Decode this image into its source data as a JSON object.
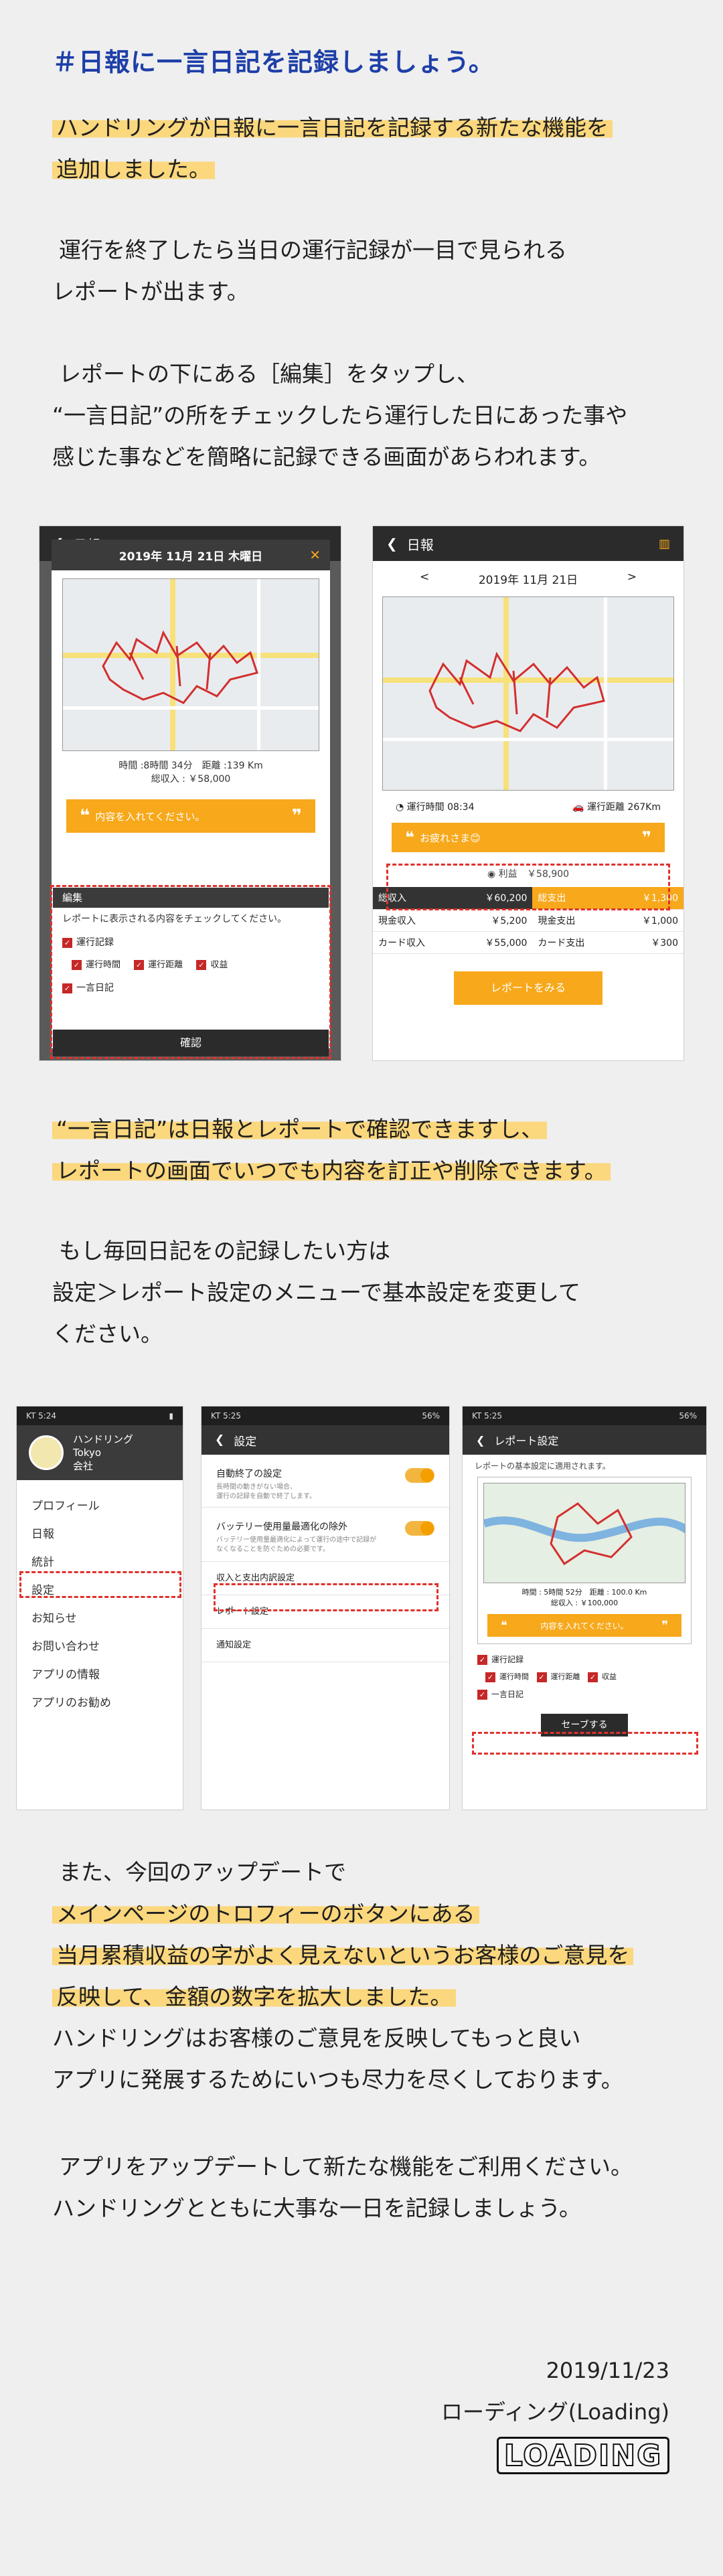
{
  "heading": "＃日報に一言日記を記録しましょう。",
  "intro_line1": "ハンドリングが日報に一言日記を記録する新たな機能を",
  "intro_line2": "追加しました。",
  "p2_line1": "運行を終了したら当日の運行記録が一目で見られる",
  "p2_line2": "レポートが出ます。",
  "p3_line1": "レポートの下にある［編集］をタップし、",
  "p3_line2": "“一言日記”の所をチェックしたら運行した日にあった事や",
  "p3_line3": "感じた事などを簡略に記録できる画面があらわれます。",
  "screen1": {
    "appbar_title": "日報",
    "date": "2019年 11月 21日 木曜日",
    "close": "✕",
    "stats_line1": "時間 :8時間 34分　距離 :139 Km",
    "stats_line2": "総収入 : ￥58,000",
    "memo_placeholder": "内容を入れてください。",
    "edit_label": "編集",
    "edit_desc": "レポートに表示される内容をチェックしてください。",
    "cb_run": "運行記録",
    "cb_time": "運行時間",
    "cb_distance": "運行距離",
    "cb_income": "収益",
    "cb_diary": "一言日記",
    "confirm": "確認"
  },
  "screen2": {
    "appbar_title": "日報",
    "prev": "<",
    "next": ">",
    "date": "2019年 11月 21日",
    "run_time_label": "運行時間",
    "run_time": "08:34",
    "run_dist_label": "運行距離",
    "run_dist": "267Km",
    "memo": "お疲れさま😊",
    "profit_label": "利益",
    "profit": "￥58,900",
    "table": [
      [
        "総収入",
        "￥60,200",
        "総支出",
        "￥1,300"
      ],
      [
        "現金収入",
        "￥5,200",
        "現金支出",
        "￥1,000"
      ],
      [
        "カード収入",
        "￥55,000",
        "カード支出",
        "￥300"
      ]
    ],
    "report_button": "レポートをみる"
  },
  "p4_line1": "“一言日記”は日報とレポートで確認できますし、",
  "p4_line2": "レポートの画面でいつでも内容を訂正や削除できます。",
  "p5_line1": "もし毎回日記をの記録したい方は",
  "p5_line2": "設定＞レポート設定のメニューで基本設定を変更して",
  "p5_line3": "ください。",
  "screen3": {
    "status_time": "KT 5:24",
    "user_name": "ハンドリング",
    "user_sub1": "Tokyo",
    "user_sub2": "会社",
    "menu": [
      "プロフィール",
      "日報",
      "統計",
      "設定",
      "お知らせ",
      "お問い合わせ",
      "アプリの情報",
      "アプリのお勧め"
    ]
  },
  "screen4": {
    "status_time": "KT 5:25",
    "status_right": "56%",
    "appbar_title": "設定",
    "auto_end": "自動終了の設定",
    "auto_end_desc1": "長時間の動きがない場合、",
    "auto_end_desc2": "運行の記録を自動で終了します。",
    "battery": "バッテリー使用量最適化の除外",
    "battery_desc1": "バッテリー使用量最適化によって運行の途中で記録が",
    "battery_desc2": "なくなることを防ぐための必要です。",
    "item_income": "収入と支出内訳設定",
    "item_report": "レポート設定",
    "item_notice": "通知設定"
  },
  "screen5": {
    "status_time": "KT 5:25",
    "status_right": "56%",
    "appbar_title": "レポート設定",
    "desc": "レポートの基本設定に適用されます。",
    "stats_line1": "時間 : 5時間 52分　距離 : 100.0 Km",
    "stats_line2": "総収入 : ￥100,000",
    "memo_placeholder": "内容を入れてください。",
    "cb_run": "運行記録",
    "cb_time": "運行時間",
    "cb_distance": "運行距離",
    "cb_income": "収益",
    "cb_diary": "一言日記",
    "save": "セーブする"
  },
  "p6_line1": "また、今回のアップデートで",
  "p6_line2": "メインページのトロフィーのボタンにある",
  "p6_line3": "当月累積収益の字がよく見えないというお客様のご意見を",
  "p6_line4": "反映して、金額の数字を拡大しました。",
  "p6_line5": "ハンドリングはお客様のご意見を反映してもっと良い",
  "p6_line6": "アプリに発展するためにいつも尽力を尽くしております。",
  "p7_line1": "アプリをアップデートして新たな機能をご利用ください。",
  "p7_line2": "ハンドリングとともに大事な一日を記録しましょう。",
  "footer_date": "2019/11/23",
  "footer_name": "ローディング(Loading)",
  "logo_text": "LOADING",
  "colors": {
    "accent_orange": "#f7a81b",
    "highlight": "#fbd77d",
    "heading_blue": "#1e3fa8",
    "alert_red": "#e0312c"
  }
}
